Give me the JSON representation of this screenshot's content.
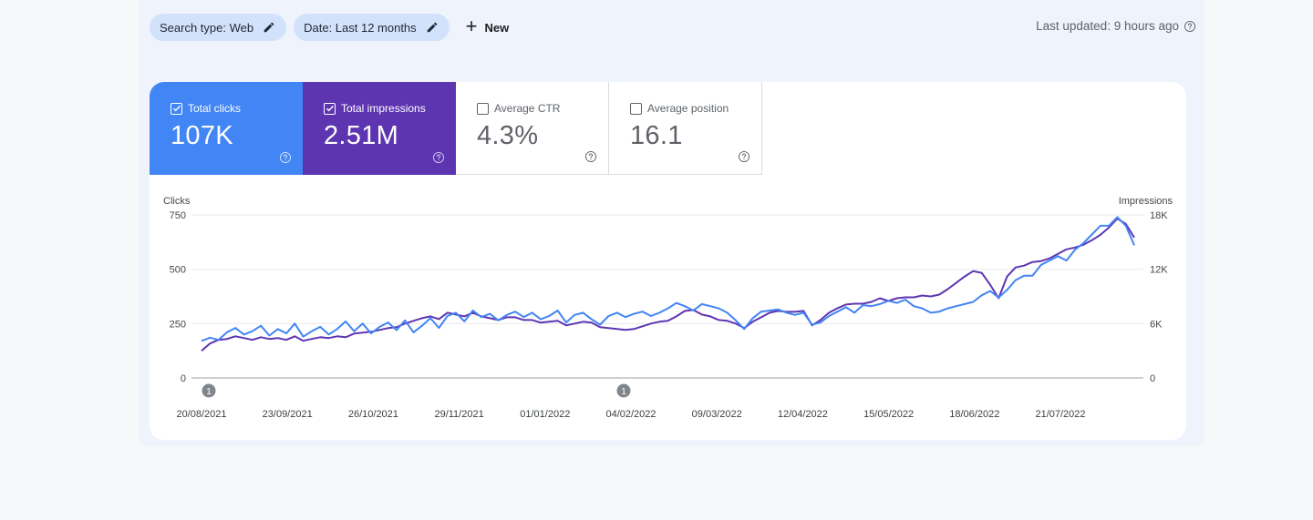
{
  "filters": {
    "search_type": "Search type: Web",
    "date_range": "Date: Last 12 months",
    "new_label": "New"
  },
  "last_updated": "Last updated: 9 hours ago",
  "metrics": [
    {
      "label": "Total clicks",
      "value": "107K",
      "checked": true
    },
    {
      "label": "Total impressions",
      "value": "2.51M",
      "checked": true
    },
    {
      "label": "Average CTR",
      "value": "4.3%",
      "checked": false
    },
    {
      "label": "Average position",
      "value": "16.1",
      "checked": false
    }
  ],
  "colors": {
    "clicks": "#4285f4",
    "impressions": "#5e35b1",
    "panel": "#eef3fc",
    "chip": "#d3e2fb"
  },
  "chart_data": {
    "type": "line",
    "left_axis_label": "Clicks",
    "right_axis_label": "Impressions",
    "left_ticks": [
      "750",
      "500",
      "250",
      "0"
    ],
    "right_ticks": [
      "18K",
      "12K",
      "6K",
      "0"
    ],
    "left_ylim": [
      0,
      750
    ],
    "right_ylim": [
      0,
      18000
    ],
    "x_tick_labels": [
      "20/08/2021",
      "23/09/2021",
      "26/10/2021",
      "29/11/2021",
      "01/01/2022",
      "04/02/2022",
      "09/03/2022",
      "12/04/2022",
      "15/05/2022",
      "18/06/2022",
      "21/07/2022"
    ],
    "grid": true,
    "annotations": [
      {
        "label": "1",
        "date": "20/08/2021"
      },
      {
        "label": "1",
        "date": "04/02/2022"
      }
    ],
    "series": [
      {
        "name": "Total clicks",
        "axis": "left",
        "color": "#4285f4",
        "values": [
          170,
          185,
          175,
          210,
          230,
          200,
          215,
          240,
          195,
          225,
          205,
          250,
          190,
          215,
          235,
          200,
          225,
          260,
          215,
          250,
          205,
          235,
          255,
          220,
          265,
          210,
          240,
          275,
          230,
          285,
          300,
          260,
          310,
          280,
          295,
          265,
          290,
          305,
          280,
          300,
          270,
          285,
          310,
          255,
          290,
          300,
          270,
          245,
          285,
          300,
          280,
          295,
          305,
          285,
          300,
          320,
          345,
          330,
          310,
          340,
          330,
          320,
          300,
          265,
          225,
          275,
          305,
          310,
          315,
          300,
          290,
          300,
          245,
          255,
          285,
          305,
          325,
          300,
          335,
          330,
          340,
          355,
          345,
          360,
          330,
          320,
          300,
          305,
          320,
          330,
          340,
          350,
          380,
          400,
          370,
          405,
          450,
          470,
          470,
          520,
          540,
          560,
          540,
          590,
          620,
          660,
          700,
          700,
          740,
          700,
          610
        ]
      },
      {
        "name": "Total impressions",
        "axis": "right",
        "color": "#5e35b1",
        "values": [
          3000,
          3800,
          4200,
          4300,
          4600,
          4400,
          4200,
          4500,
          4300,
          4400,
          4200,
          4600,
          4100,
          4300,
          4500,
          4400,
          4600,
          4500,
          4900,
          5000,
          5100,
          5300,
          5500,
          5600,
          6000,
          6300,
          6600,
          6800,
          6500,
          7200,
          7000,
          6800,
          7200,
          6800,
          6600,
          6400,
          6700,
          6700,
          6400,
          6400,
          6100,
          6200,
          6300,
          5800,
          6000,
          6200,
          6100,
          5600,
          5500,
          5400,
          5300,
          5400,
          5700,
          6000,
          6200,
          6300,
          6800,
          7400,
          7500,
          7000,
          6800,
          6400,
          6300,
          6000,
          5500,
          6200,
          6700,
          7200,
          7400,
          7300,
          7300,
          7400,
          5800,
          6400,
          7200,
          7700,
          8100,
          8200,
          8200,
          8400,
          8800,
          8500,
          8800,
          8900,
          8900,
          9100,
          9000,
          9200,
          9800,
          10500,
          11200,
          11800,
          11600,
          10300,
          8800,
          11200,
          12200,
          12400,
          12800,
          12900,
          13200,
          13700,
          14200,
          14400,
          14700,
          15200,
          15800,
          16600,
          17600,
          17000,
          15500
        ]
      }
    ]
  }
}
